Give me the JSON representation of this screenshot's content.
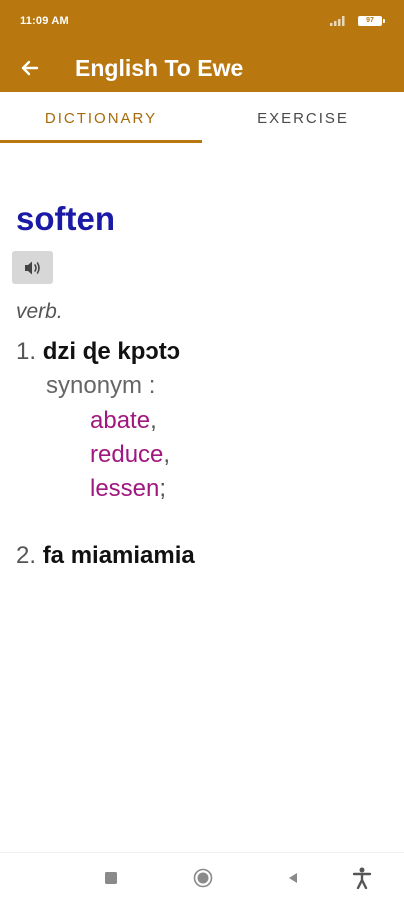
{
  "status_bar": {
    "time": "11:09 AM",
    "battery": "97",
    "icons": [
      "signal-icon",
      "battery-icon"
    ]
  },
  "app_bar": {
    "title": "English To Ewe",
    "back_icon": "back-arrow-icon"
  },
  "tabs": [
    {
      "label": "DICTIONARY",
      "selected": true
    },
    {
      "label": "EXERCISE",
      "selected": false
    }
  ],
  "entry": {
    "headword": "soften",
    "speaker_icon": "speaker-icon",
    "part_of_speech": "verb.",
    "senses": [
      {
        "number": "1.",
        "translation": "dzi ɖe kpɔtɔ",
        "synonym_label": "synonym :",
        "synonyms": [
          {
            "word": "abate",
            "punct": ","
          },
          {
            "word": "reduce",
            "punct": ","
          },
          {
            "word": "lessen",
            "punct": ";"
          }
        ]
      },
      {
        "number": "2.",
        "translation": "fa miamiamia"
      }
    ]
  },
  "nav_bar": {
    "icons": [
      "recents-square-icon",
      "home-circle-icon",
      "back-triangle-icon",
      "accessibility-icon"
    ]
  },
  "colors": {
    "primary": "#b8780f",
    "headword": "#1a1aa6",
    "synonym": "#a0177f",
    "tab_selected": "#a86a0a"
  }
}
